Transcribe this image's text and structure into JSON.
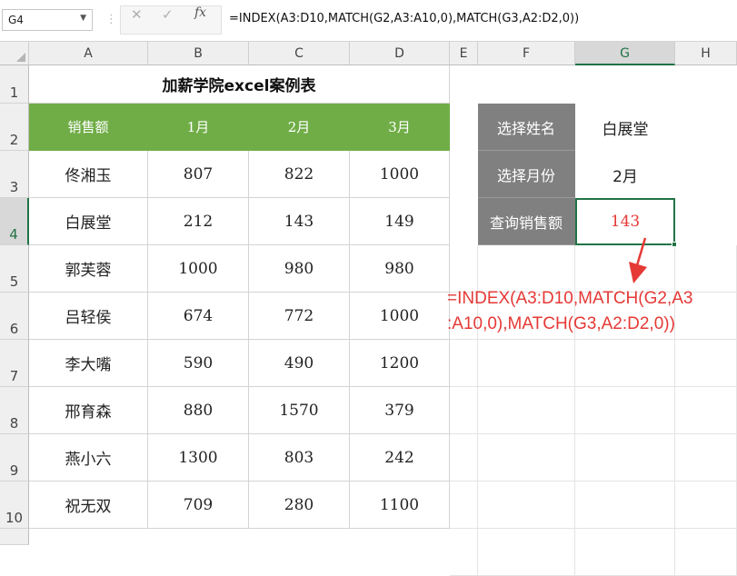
{
  "formula_bar": {
    "name_box": "G4",
    "cancel_icon": "✕",
    "enter_icon": "✓",
    "fx_label": "fx",
    "formula": "=INDEX(A3:D10,MATCH(G2,A3:A10,0),MATCH(G3,A2:D2,0))"
  },
  "columns": [
    "A",
    "B",
    "C",
    "D",
    "E",
    "F",
    "G",
    "H"
  ],
  "rows": [
    "1",
    "2",
    "3",
    "4",
    "5",
    "6",
    "7",
    "8",
    "9",
    "10"
  ],
  "sheet": {
    "title": "加薪学院excel案例表",
    "headers": [
      "销售额",
      "1月",
      "2月",
      "3月"
    ],
    "data": [
      {
        "name": "佟湘玉",
        "m1": "807",
        "m2": "822",
        "m3": "1000"
      },
      {
        "name": "白展堂",
        "m1": "212",
        "m2": "143",
        "m3": "149"
      },
      {
        "name": "郭芙蓉",
        "m1": "1000",
        "m2": "980",
        "m3": "980"
      },
      {
        "name": "吕轻侯",
        "m1": "674",
        "m2": "772",
        "m3": "1000"
      },
      {
        "name": "李大嘴",
        "m1": "590",
        "m2": "490",
        "m3": "1200"
      },
      {
        "name": "邢育森",
        "m1": "880",
        "m2": "1570",
        "m3": "379"
      },
      {
        "name": "燕小六",
        "m1": "1300",
        "m2": "803",
        "m3": "242"
      },
      {
        "name": "祝无双",
        "m1": "709",
        "m2": "280",
        "m3": "1100"
      }
    ]
  },
  "lookup": {
    "name_label": "选择姓名",
    "name_value": "白展堂",
    "month_label": "选择月份",
    "month_value": "2月",
    "result_label": "查询销售额",
    "result_value": "143"
  },
  "annotation": {
    "line1": "=INDEX(A3:D10,MATCH(G2,A3",
    "line2": ":A10,0),MATCH(G3,A2:D2,0))"
  },
  "colors": {
    "header_green": "#70ad47",
    "label_gray": "#808080",
    "accent_red": "#e53935",
    "excel_green": "#217346"
  }
}
